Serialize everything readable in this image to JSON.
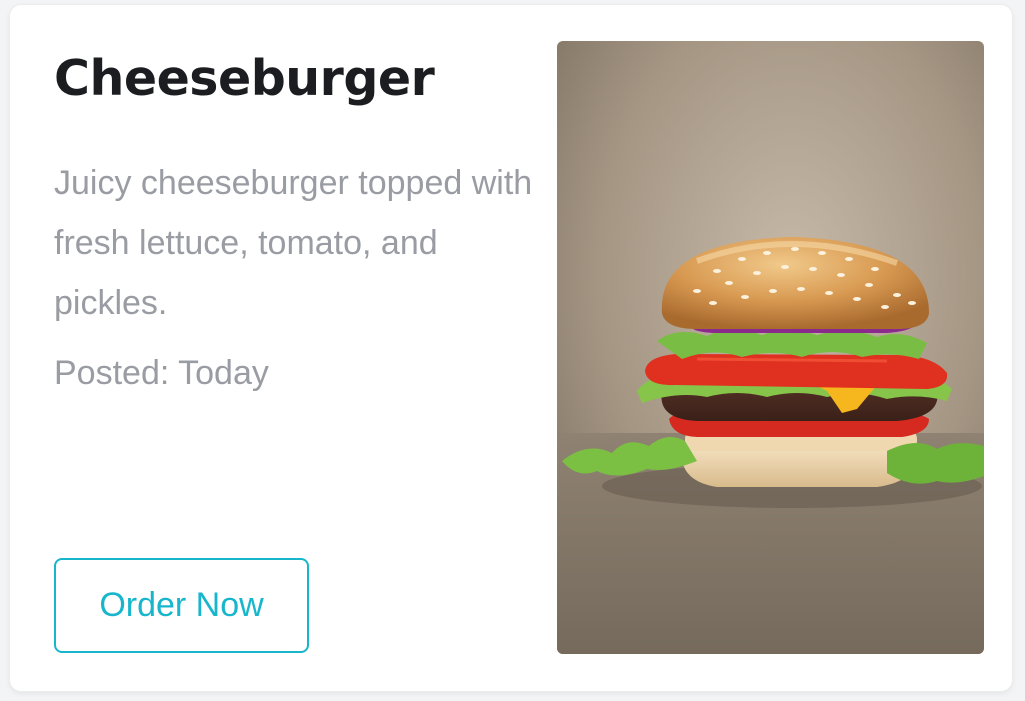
{
  "card": {
    "title": "Cheeseburger",
    "description": "Juicy cheeseburger topped with fresh lettuce, tomato, and pickles.",
    "posted": "Posted: Today",
    "button_label": "Order Now",
    "accent_color": "#18b6cc"
  }
}
